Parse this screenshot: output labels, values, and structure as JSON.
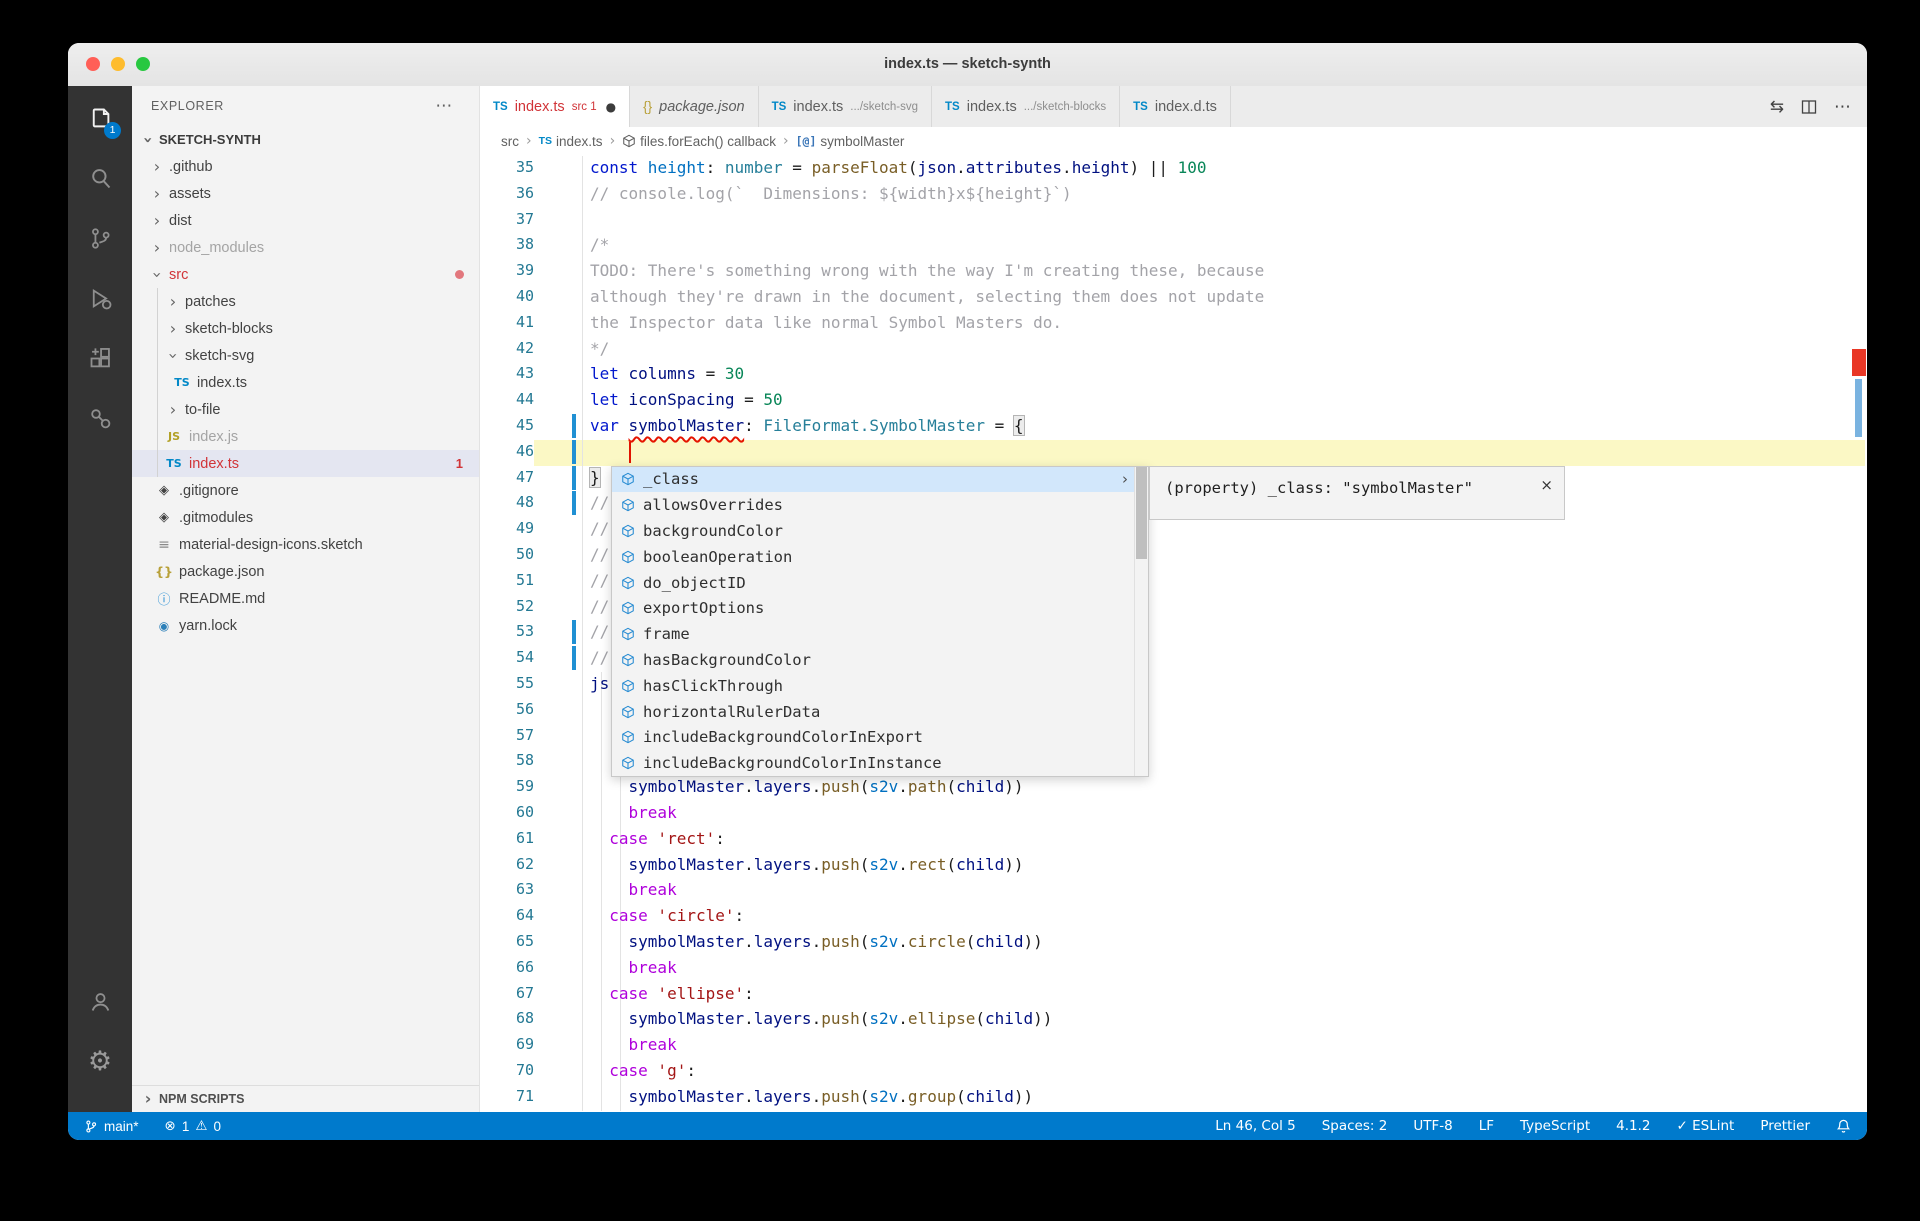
{
  "colors": {
    "accent": "#007acc",
    "error": "#d13438",
    "keyword": "#0218cd",
    "type": "#267f99",
    "string": "#a31515",
    "number": "#098658",
    "comment": "#a3a3a8",
    "current_line": "#fbf8c5"
  },
  "window": {
    "title": "index.ts — sketch-synth"
  },
  "activity_bar": {
    "badge": "1",
    "icons": [
      "files-icon",
      "search-icon",
      "source-control-icon",
      "run-debug-icon",
      "extensions-icon",
      "references-icon",
      "account-icon",
      "settings-gear-icon"
    ]
  },
  "sidebar": {
    "header": "EXPLORER",
    "more": "⋯",
    "section": "SKETCH-SYNTH",
    "npm_scripts": "NPM SCRIPTS",
    "tree": [
      {
        "label": ".github",
        "kind": "folder",
        "expanded": false,
        "level": 1
      },
      {
        "label": "assets",
        "kind": "folder",
        "expanded": false,
        "level": 1
      },
      {
        "label": "dist",
        "kind": "folder",
        "expanded": false,
        "level": 1
      },
      {
        "label": "node_modules",
        "kind": "folder",
        "expanded": false,
        "level": 1,
        "dim": true
      },
      {
        "label": "src",
        "kind": "folder",
        "expanded": true,
        "level": 1,
        "red": true,
        "dot": true
      },
      {
        "label": "patches",
        "kind": "folder",
        "expanded": false,
        "level": 2
      },
      {
        "label": "sketch-blocks",
        "kind": "folder",
        "expanded": false,
        "level": 2
      },
      {
        "label": "sketch-svg",
        "kind": "folder",
        "expanded": true,
        "level": 2
      },
      {
        "label": "index.ts",
        "kind": "file",
        "icon": "ts",
        "level": 3
      },
      {
        "label": "to-file",
        "kind": "folder",
        "expanded": false,
        "level": 2
      },
      {
        "label": "index.js",
        "kind": "file",
        "icon": "js",
        "level": 2,
        "dim": true
      },
      {
        "label": "index.ts",
        "kind": "file",
        "icon": "ts",
        "level": 2,
        "red": true,
        "selected": true,
        "badge": "1"
      },
      {
        "label": ".gitignore",
        "kind": "file",
        "icon": "git",
        "level": 1
      },
      {
        "label": ".gitmodules",
        "kind": "file",
        "icon": "git",
        "level": 1
      },
      {
        "label": "material-design-icons.sketch",
        "kind": "file",
        "icon": "file",
        "level": 1
      },
      {
        "label": "package.json",
        "kind": "file",
        "icon": "json",
        "level": 1
      },
      {
        "label": "README.md",
        "kind": "file",
        "icon": "info",
        "level": 1
      },
      {
        "label": "yarn.lock",
        "kind": "file",
        "icon": "yarn",
        "level": 1
      }
    ]
  },
  "editor": {
    "tabs": [
      {
        "icon": "ts",
        "icon_text": "TS",
        "name": "index.ts",
        "name_err": true,
        "desc": "src 1",
        "desc_err": true,
        "dot": "●",
        "active": true
      },
      {
        "icon": "json",
        "icon_text": "{}",
        "name": "package.json",
        "italic": true
      },
      {
        "icon": "ts",
        "icon_text": "TS",
        "name": "index.ts",
        "desc": ".../sketch-svg"
      },
      {
        "icon": "ts",
        "icon_text": "TS",
        "name": "index.ts",
        "desc": ".../sketch-blocks"
      },
      {
        "icon": "ts",
        "icon_text": "TS",
        "name": "index.d.ts"
      }
    ],
    "actions": [
      "open-changes-icon",
      "split-editor-icon",
      "more-actions-icon"
    ],
    "action_glyphs": {
      "open_changes": "⇆",
      "more": "⋯"
    },
    "breadcrumbs": [
      {
        "label": "src"
      },
      {
        "label": "index.ts",
        "icon": "ts",
        "icon_text": "TS"
      },
      {
        "label": "files.forEach() callback",
        "icon": "cube"
      },
      {
        "label": "symbolMaster",
        "icon": "at",
        "icon_text": "[@]"
      }
    ]
  },
  "code": {
    "first_line": 35,
    "cursor": {
      "line": 46,
      "col": 5
    },
    "modified_lines": [
      45,
      46,
      47,
      48,
      53,
      54
    ],
    "lines": [
      {
        "n": 35,
        "tk": [
          [
            "k",
            "const"
          ],
          [
            "b",
            " height"
          ],
          [
            "p",
            ": "
          ],
          [
            "t",
            "number"
          ],
          [
            "p",
            " = "
          ],
          [
            "f",
            "parseFloat"
          ],
          [
            "p",
            "("
          ],
          [
            "v",
            "json"
          ],
          [
            "p",
            "."
          ],
          [
            "v",
            "attributes"
          ],
          [
            "p",
            "."
          ],
          [
            "v",
            "height"
          ],
          [
            "p",
            ") || "
          ],
          [
            "n",
            "100"
          ]
        ]
      },
      {
        "n": 36,
        "tk": [
          [
            "m",
            "// console.log(`  Dimensions: ${width}x${height}`)"
          ]
        ]
      },
      {
        "n": 37,
        "tk": []
      },
      {
        "n": 38,
        "tk": [
          [
            "m",
            "/*"
          ]
        ]
      },
      {
        "n": 39,
        "tk": [
          [
            "m",
            "TODO: There's something wrong with the way I'm creating these, because"
          ]
        ]
      },
      {
        "n": 40,
        "tk": [
          [
            "m",
            "although they're drawn in the document, selecting them does not update"
          ]
        ]
      },
      {
        "n": 41,
        "tk": [
          [
            "m",
            "the Inspector data like normal Symbol Masters do."
          ]
        ]
      },
      {
        "n": 42,
        "tk": [
          [
            "m",
            "*/"
          ]
        ]
      },
      {
        "n": 43,
        "tk": [
          [
            "k",
            "let"
          ],
          [
            "v",
            " columns"
          ],
          [
            "p",
            " = "
          ],
          [
            "n",
            "30"
          ]
        ]
      },
      {
        "n": 44,
        "tk": [
          [
            "k",
            "let"
          ],
          [
            "v",
            " iconSpacing"
          ],
          [
            "p",
            " = "
          ],
          [
            "n",
            "50"
          ]
        ]
      },
      {
        "n": 45,
        "tk": [
          [
            "k",
            "var"
          ],
          [
            "p",
            " "
          ],
          [
            "w",
            "symbolMaster"
          ],
          [
            "p",
            ": "
          ],
          [
            "t",
            "FileFormat.SymbolMaster"
          ],
          [
            "p",
            " = "
          ],
          [
            "x",
            "{"
          ]
        ]
      },
      {
        "n": 46,
        "tk": []
      },
      {
        "n": 47,
        "tk": [
          [
            "x",
            "}"
          ]
        ]
      },
      {
        "n": 48,
        "tk": [
          [
            "m",
            "//"
          ]
        ]
      },
      {
        "n": 49,
        "tk": [
          [
            "m",
            "//"
          ]
        ]
      },
      {
        "n": 50,
        "tk": [
          [
            "m",
            "//"
          ]
        ]
      },
      {
        "n": 51,
        "tk": [
          [
            "m",
            "//"
          ]
        ]
      },
      {
        "n": 52,
        "tk": [
          [
            "m",
            "//"
          ]
        ]
      },
      {
        "n": 53,
        "tk": [
          [
            "m",
            "//"
          ]
        ]
      },
      {
        "n": 54,
        "tk": [
          [
            "m",
            "//"
          ]
        ]
      },
      {
        "n": 55,
        "tk": [
          [
            "v",
            "js"
          ]
        ]
      },
      {
        "n": 56,
        "tk": []
      },
      {
        "n": 57,
        "tk": []
      },
      {
        "n": 58,
        "tk": []
      },
      {
        "n": 59,
        "tk": [
          [
            "p",
            "    "
          ],
          [
            "v",
            "symbolMaster"
          ],
          [
            "p",
            "."
          ],
          [
            "v",
            "layers"
          ],
          [
            "p",
            "."
          ],
          [
            "f",
            "push"
          ],
          [
            "p",
            "("
          ],
          [
            "b",
            "s2v"
          ],
          [
            "p",
            "."
          ],
          [
            "f",
            "path"
          ],
          [
            "p",
            "("
          ],
          [
            "v",
            "child"
          ],
          [
            "p",
            "))"
          ]
        ]
      },
      {
        "n": 60,
        "tk": [
          [
            "p",
            "    "
          ],
          [
            "c",
            "break"
          ]
        ]
      },
      {
        "n": 61,
        "tk": [
          [
            "p",
            "  "
          ],
          [
            "c",
            "case"
          ],
          [
            "s",
            " 'rect'"
          ],
          [
            "p",
            ":"
          ]
        ]
      },
      {
        "n": 62,
        "tk": [
          [
            "p",
            "    "
          ],
          [
            "v",
            "symbolMaster"
          ],
          [
            "p",
            "."
          ],
          [
            "v",
            "layers"
          ],
          [
            "p",
            "."
          ],
          [
            "f",
            "push"
          ],
          [
            "p",
            "("
          ],
          [
            "b",
            "s2v"
          ],
          [
            "p",
            "."
          ],
          [
            "f",
            "rect"
          ],
          [
            "p",
            "("
          ],
          [
            "v",
            "child"
          ],
          [
            "p",
            "))"
          ]
        ]
      },
      {
        "n": 63,
        "tk": [
          [
            "p",
            "    "
          ],
          [
            "c",
            "break"
          ]
        ]
      },
      {
        "n": 64,
        "tk": [
          [
            "p",
            "  "
          ],
          [
            "c",
            "case"
          ],
          [
            "s",
            " 'circle'"
          ],
          [
            "p",
            ":"
          ]
        ]
      },
      {
        "n": 65,
        "tk": [
          [
            "p",
            "    "
          ],
          [
            "v",
            "symbolMaster"
          ],
          [
            "p",
            "."
          ],
          [
            "v",
            "layers"
          ],
          [
            "p",
            "."
          ],
          [
            "f",
            "push"
          ],
          [
            "p",
            "("
          ],
          [
            "b",
            "s2v"
          ],
          [
            "p",
            "."
          ],
          [
            "f",
            "circle"
          ],
          [
            "p",
            "("
          ],
          [
            "v",
            "child"
          ],
          [
            "p",
            "))"
          ]
        ]
      },
      {
        "n": 66,
        "tk": [
          [
            "p",
            "    "
          ],
          [
            "c",
            "break"
          ]
        ]
      },
      {
        "n": 67,
        "tk": [
          [
            "p",
            "  "
          ],
          [
            "c",
            "case"
          ],
          [
            "s",
            " 'ellipse'"
          ],
          [
            "p",
            ":"
          ]
        ]
      },
      {
        "n": 68,
        "tk": [
          [
            "p",
            "    "
          ],
          [
            "v",
            "symbolMaster"
          ],
          [
            "p",
            "."
          ],
          [
            "v",
            "layers"
          ],
          [
            "p",
            "."
          ],
          [
            "f",
            "push"
          ],
          [
            "p",
            "("
          ],
          [
            "b",
            "s2v"
          ],
          [
            "p",
            "."
          ],
          [
            "f",
            "ellipse"
          ],
          [
            "p",
            "("
          ],
          [
            "v",
            "child"
          ],
          [
            "p",
            "))"
          ]
        ]
      },
      {
        "n": 69,
        "tk": [
          [
            "p",
            "    "
          ],
          [
            "c",
            "break"
          ]
        ]
      },
      {
        "n": 70,
        "tk": [
          [
            "p",
            "  "
          ],
          [
            "c",
            "case"
          ],
          [
            "s",
            " 'g'"
          ],
          [
            "p",
            ":"
          ]
        ]
      },
      {
        "n": 71,
        "tk": [
          [
            "p",
            "    "
          ],
          [
            "v",
            "symbolMaster"
          ],
          [
            "p",
            "."
          ],
          [
            "v",
            "layers"
          ],
          [
            "p",
            "."
          ],
          [
            "f",
            "push"
          ],
          [
            "p",
            "("
          ],
          [
            "b",
            "s2v"
          ],
          [
            "p",
            "."
          ],
          [
            "f",
            "group"
          ],
          [
            "p",
            "("
          ],
          [
            "v",
            "child"
          ],
          [
            "p",
            "))"
          ]
        ]
      }
    ]
  },
  "suggest": {
    "selected": "_class",
    "selected_chevron": "›",
    "items": [
      "_class",
      "allowsOverrides",
      "backgroundColor",
      "booleanOperation",
      "do_objectID",
      "exportOptions",
      "frame",
      "hasBackgroundColor",
      "hasClickThrough",
      "horizontalRulerData",
      "includeBackgroundColorInExport",
      "includeBackgroundColorInInstance"
    ],
    "doc": "(property) _class: \"symbolMaster\"",
    "doc_close": "×"
  },
  "status_bar": {
    "branch": "main*",
    "error_icon": "⊗",
    "errors": "1",
    "warning_icon": "⚠",
    "warnings": "0",
    "items_right": [
      "Ln 46, Col 5",
      "Spaces: 2",
      "UTF-8",
      "LF",
      "TypeScript",
      "4.1.2",
      "✓ ESLint",
      "Prettier"
    ]
  }
}
